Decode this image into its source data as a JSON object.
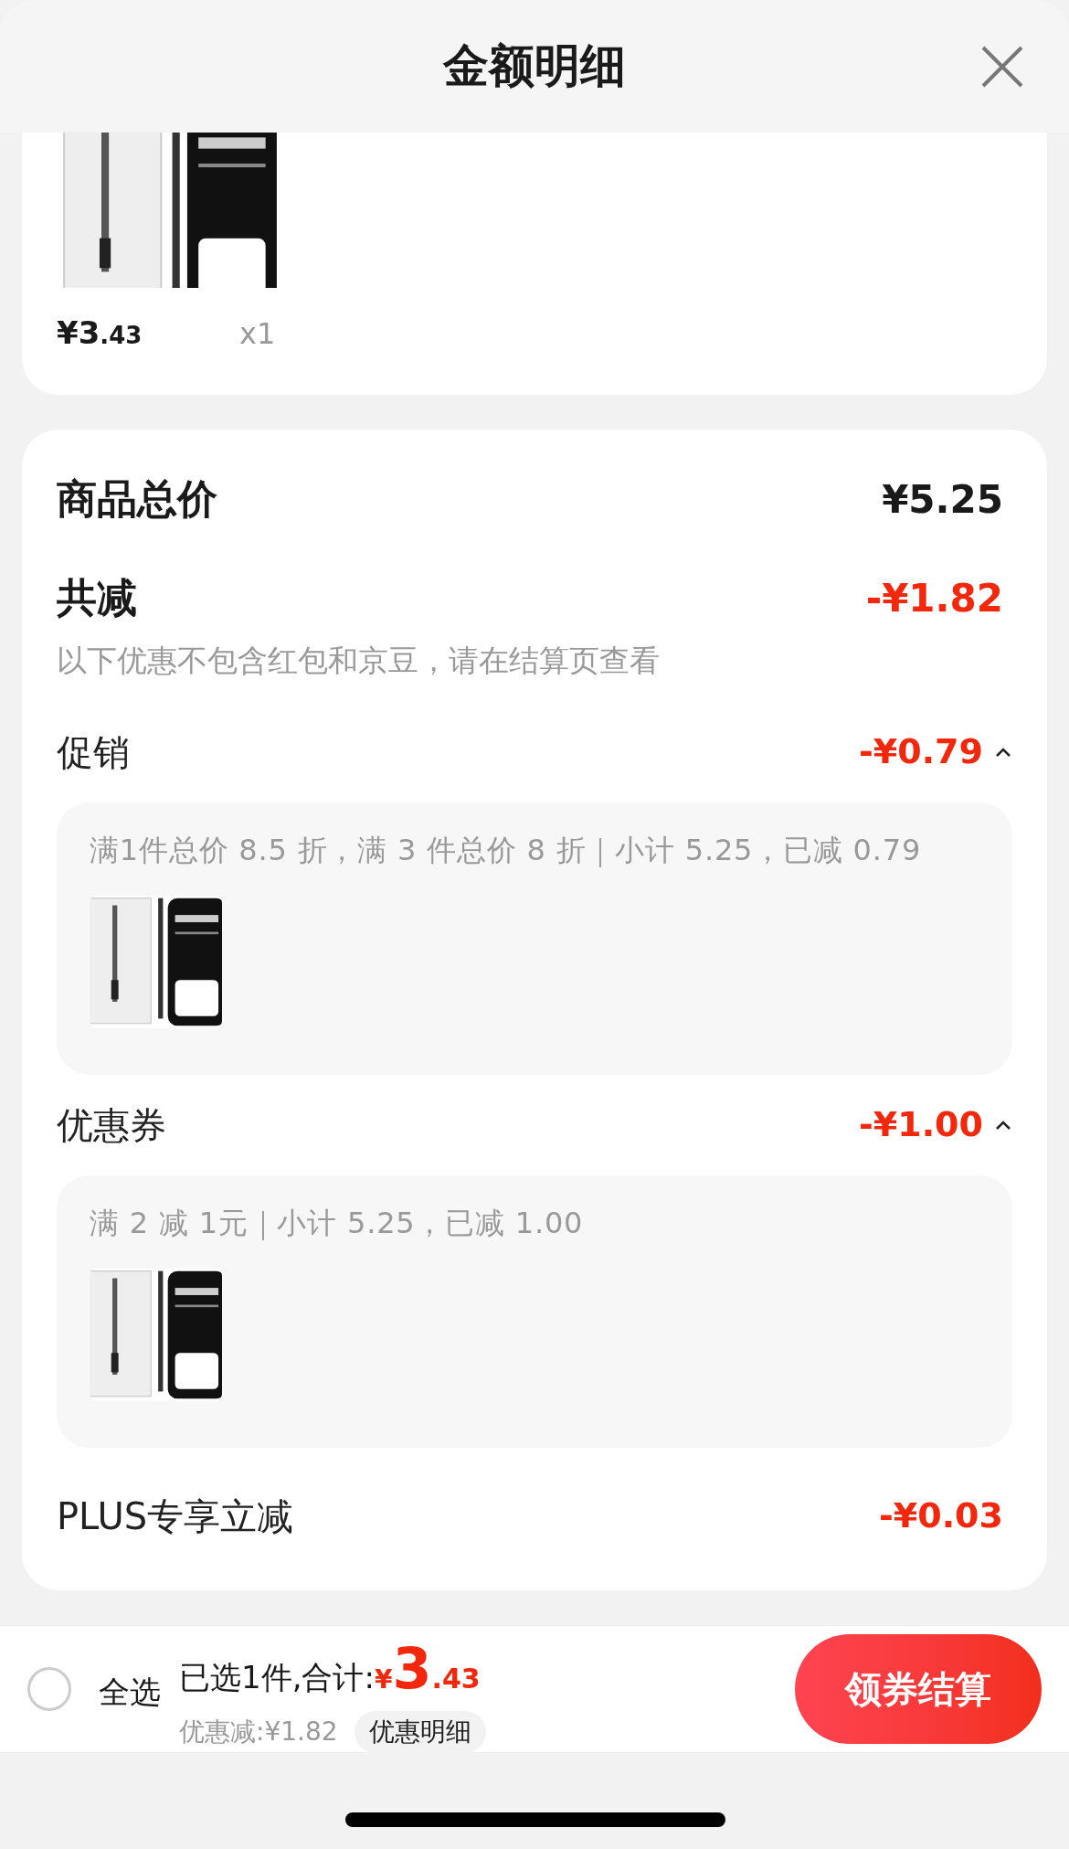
{
  "header": {
    "title": "金额明细"
  },
  "item": {
    "kind": "picture",
    "price": {
      "symbol": "¥",
      "integer": "3",
      "decimal": ".43"
    },
    "quantity": "x1"
  },
  "summary": {
    "total_label": "商品总价",
    "total": "¥5.25",
    "discount_label": "共减",
    "discount": "-¥1.82",
    "note": "以下优惠不包含红包和京豆，请在结算页查看"
  },
  "discounts": [
    {
      "kind": "group",
      "label": "促销",
      "amount": "-¥0.79",
      "expanded": true,
      "detail": "满1件总价 8.5 折，满 3 件总价 8 折｜小计 5.25，已减 0.79"
    },
    {
      "kind": "group",
      "label": "优惠券",
      "amount": "-¥1.00",
      "expanded": true,
      "detail": "满 2 减 1元｜小计 5.25，已减 1.00"
    },
    {
      "kind": "plain",
      "label": "PLUS专享立减",
      "amount": "-¥0.03"
    }
  ],
  "footer": {
    "select_all": {
      "label": "全选",
      "selected": false
    },
    "selected_text": "已选1件,合计:",
    "total": {
      "symbol": "¥",
      "integer": "3",
      "decimal": ".43"
    },
    "saved": "优惠减:¥1.82",
    "detail_link": "优惠明细",
    "checkout": "领券结算"
  }
}
